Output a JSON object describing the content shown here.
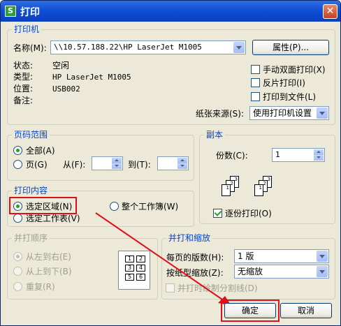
{
  "window": {
    "title": "打印",
    "app_badge": "S"
  },
  "printer": {
    "group_title": "打印机",
    "name_label": "名称(M):",
    "name_value": "\\\\10.57.188.22\\HP LaserJet M1005",
    "properties_button": "属性(P)...",
    "status_label": "状态:",
    "status_value": "空闲",
    "type_label": "类型:",
    "type_value": "HP LaserJet M1005",
    "location_label": "位置:",
    "location_value": "USB002",
    "comment_label": "备注:",
    "duplex_label": "手动双面打印(X)",
    "reverse_label": "反片打印(I)",
    "to_file_label": "打印到文件(L)",
    "paper_source_label": "纸张来源(S):",
    "paper_source_value": "使用打印机设置"
  },
  "page_range": {
    "group_title": "页码范围",
    "all_label": "全部(A)",
    "pages_label": "页(G)",
    "from_label": "从(F):",
    "to_label": "到(T):"
  },
  "copies": {
    "group_title": "副本",
    "count_label": "份数(C):",
    "count_value": "1",
    "collate_label": "逐份打印(O)",
    "collate_pages": [
      "1",
      "2",
      "3"
    ]
  },
  "print_content": {
    "group_title": "打印内容",
    "selection_label": "选定区域(N)",
    "workbook_label": "整个工作簿(W)",
    "worksheet_label": "选定工作表(V)"
  },
  "order": {
    "group_title": "并打顺序",
    "left_right_label": "从左到右(E)",
    "top_bottom_label": "从上到下(B)",
    "repeat_label": "重复(R)",
    "grid_numbers": [
      "1",
      "2",
      "3",
      "4",
      "5",
      "6"
    ]
  },
  "zoom": {
    "group_title": "并打和缩放",
    "pages_per_sheet_label": "每页的版数(H):",
    "pages_per_sheet_value": "1 版",
    "scale_label": "按纸型缩放(Z):",
    "scale_value": "无缩放",
    "divider_label": "并打时绘制分割线(D)"
  },
  "buttons": {
    "ok": "确定",
    "cancel": "取消"
  },
  "colors": {
    "title_bar": "#0f4fd3",
    "group_title": "#0046d5",
    "highlight": "#e0101a",
    "face": "#ece9d8"
  }
}
